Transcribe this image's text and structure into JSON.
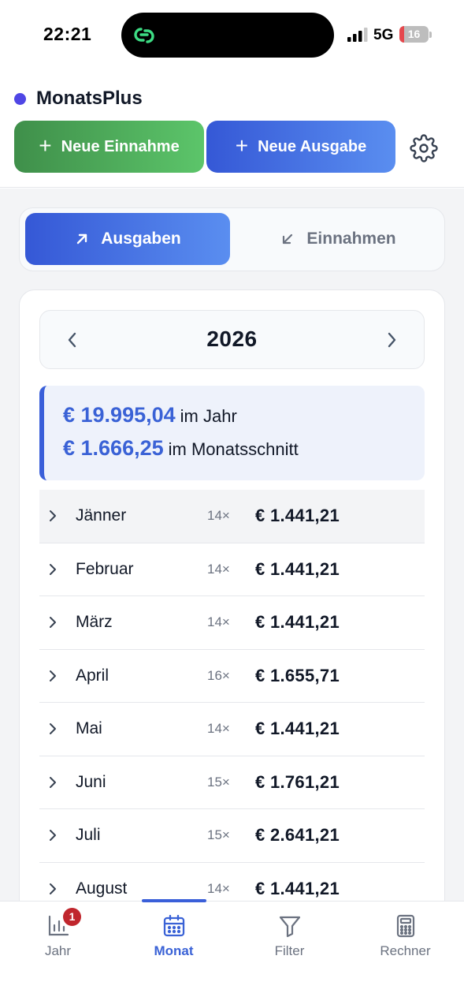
{
  "status_bar": {
    "time": "22:21",
    "network": "5G",
    "battery": "16",
    "battery_level": 0.16
  },
  "header": {
    "app_name": "MonatsPlus",
    "new_income_label": "Neue Einnahme",
    "new_expense_label": "Neue Ausgabe",
    "accent_color": "#4f46e5"
  },
  "segmented": {
    "expenses_label": "Ausgaben",
    "income_label": "Einnahmen",
    "active": "Ausgaben"
  },
  "year_nav": {
    "year": "2026"
  },
  "summary": {
    "year_amount": "€ 19.995,04",
    "year_suffix": "im Jahr",
    "avg_amount": "€ 1.666,25",
    "avg_suffix": "im Monatsschnitt"
  },
  "months": [
    {
      "name": "Jänner",
      "count": "14×",
      "amount": "€ 1.441,21"
    },
    {
      "name": "Februar",
      "count": "14×",
      "amount": "€ 1.441,21"
    },
    {
      "name": "März",
      "count": "14×",
      "amount": "€ 1.441,21"
    },
    {
      "name": "April",
      "count": "16×",
      "amount": "€ 1.655,71"
    },
    {
      "name": "Mai",
      "count": "14×",
      "amount": "€ 1.441,21"
    },
    {
      "name": "Juni",
      "count": "15×",
      "amount": "€ 1.761,21"
    },
    {
      "name": "Juli",
      "count": "15×",
      "amount": "€ 2.641,21"
    },
    {
      "name": "August",
      "count": "14×",
      "amount": "€ 1.441,21"
    }
  ],
  "tabs": [
    {
      "label": "Jahr",
      "icon": "bar-chart-icon",
      "badge": "1"
    },
    {
      "label": "Monat",
      "icon": "calendar-icon",
      "active": true
    },
    {
      "label": "Filter",
      "icon": "filter-icon"
    },
    {
      "label": "Rechner",
      "icon": "calculator-icon"
    }
  ]
}
